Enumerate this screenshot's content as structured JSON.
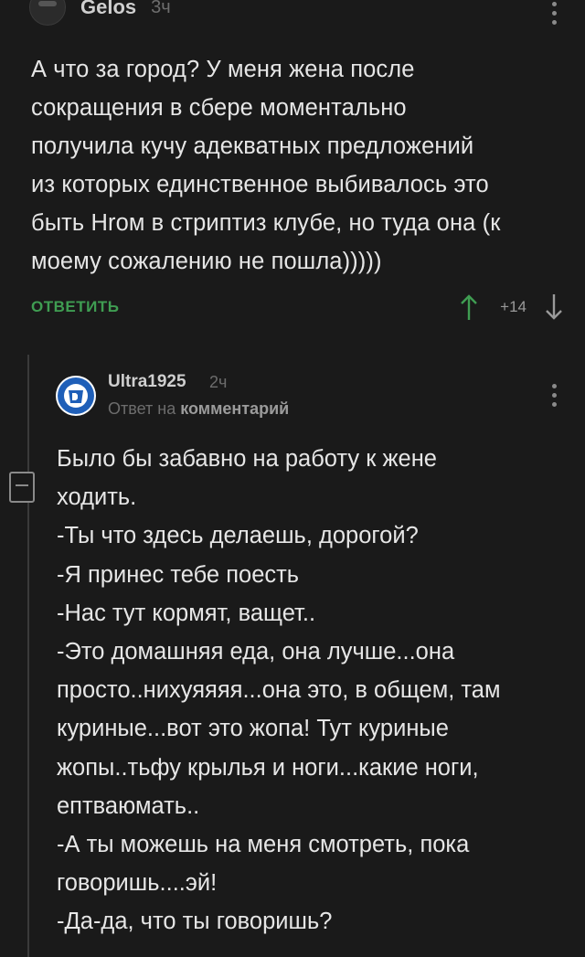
{
  "top_comment": {
    "username": "Gelos",
    "time": "3ч",
    "text_lines": [
      "А что за город? У меня жена после",
      "сокращения в сбере моментально",
      "получила кучу адекватных предложений",
      "из которых единственное выбивалось это",
      "быть Hrом в стриптиз клубе, но туда она (к",
      "моему сожалению не пошла)))))"
    ],
    "reply_label": "ОТВЕТИТЬ",
    "rating": "+14",
    "colors": {
      "reply": "#3f9d52",
      "upvote": "#3f9d52",
      "downvote": "#9a9a9a"
    }
  },
  "reply_comment": {
    "username": "Ultra1925",
    "time": "2ч",
    "reply_prefix": "Ответ на",
    "reply_link": "комментарий",
    "avatar_icon": "dynamo-badge-icon",
    "text_lines": [
      "Было бы забавно на работу к жене",
      "ходить.",
      "-Ты что здесь делаешь, дорогой?",
      "-Я принес тебе поесть",
      "-Нас тут кормят, ващет..",
      "-Это домашняя еда, она лучше...она",
      "просто..нихуяяяя...она это, в общем, там",
      "куриные...вот это жопа! Тут куриные",
      "жопы..тьфу крылья и ноги...какие ноги,",
      "ептваюмать..",
      "-А ты можешь на меня смотреть, пока",
      "говоришь....эй!",
      "-Да-да, что ты говоришь?"
    ]
  }
}
